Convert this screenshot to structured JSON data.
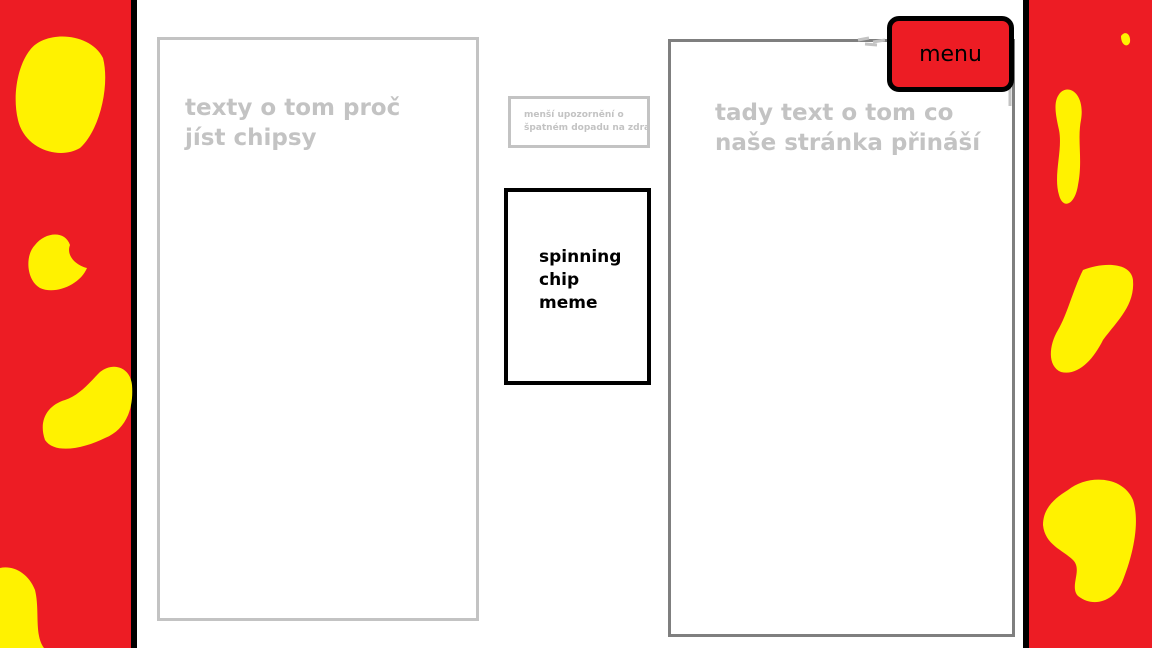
{
  "colors": {
    "strip_red": "#ed1c24",
    "chip_yellow": "#fff200",
    "outline_light": "#c3c3c3",
    "outline_dark": "#7f7f7f",
    "menu_fill": "#ed1c24"
  },
  "left_panel": {
    "text": "texty o tom proč jíst chipsy"
  },
  "warning": {
    "line1": "menší upozornění o",
    "line2": "špatném dopadu na zdraví"
  },
  "meme": {
    "line1": "spinning",
    "line2": "chip",
    "line3": "meme"
  },
  "right_panel": {
    "text": "tady text o tom co naše stránka přináší"
  },
  "menu": {
    "label": "menu"
  }
}
